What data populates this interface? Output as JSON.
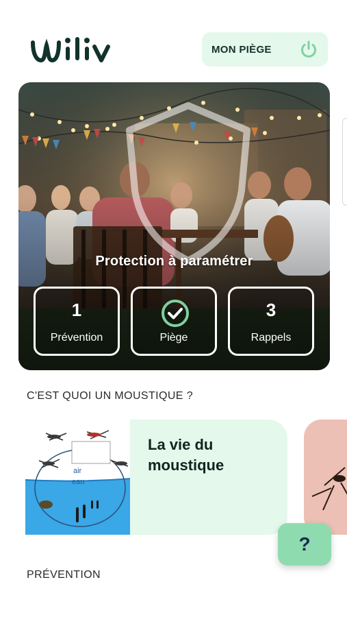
{
  "app": {
    "brand": "Wiliv"
  },
  "header": {
    "trap_label": "MON PIÈGE"
  },
  "hero": {
    "status_text": "Protection à paramétrer",
    "stats": [
      {
        "value": "1",
        "label": "Prévention"
      },
      {
        "value": "",
        "label": "Piège"
      },
      {
        "value": "3",
        "label": "Rappels"
      }
    ]
  },
  "sections": {
    "mosquito_title": "C'EST QUOI UN MOUSTIQUE ?",
    "prevention_title": "PRÉVENTION"
  },
  "cards": [
    {
      "title": "La vie du moustique",
      "diagram_labels": {
        "air": "air",
        "eau": "eau"
      }
    }
  ],
  "help": {
    "label": "?"
  },
  "colors": {
    "brand": "#12332b",
    "accent_light": "#e4f8ec",
    "accent": "#8fdbb0",
    "power_icon": "#7fd1a0"
  }
}
